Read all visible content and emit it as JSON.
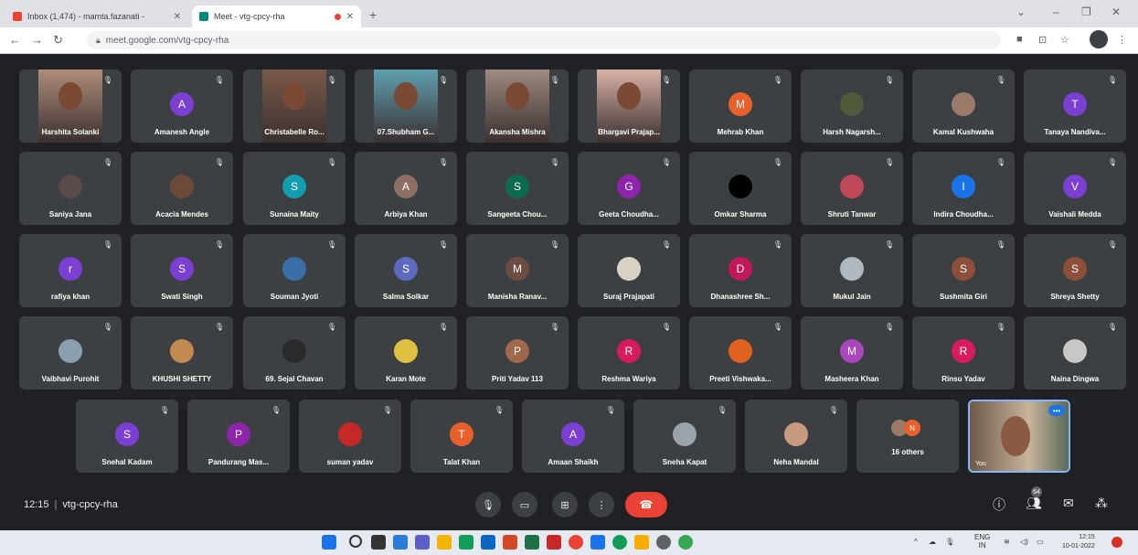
{
  "browser": {
    "tabs": [
      {
        "label": "Inbox (1,474) - mamta.fazanati - "
      },
      {
        "label": "Meet - vtg-cpcy-rha"
      }
    ],
    "url": "meet.google.com/vtg-cpcy-rha"
  },
  "meeting": {
    "time": "12:15",
    "code": "vtg-cpcy-rha",
    "participant_count": "64",
    "others_label": "16 others",
    "self_label": "You"
  },
  "participants": [
    {
      "name": "Harshita Solanki",
      "type": "video",
      "color": "#b08d7a"
    },
    {
      "name": "Amanesh Angle",
      "type": "avatar",
      "initial": "A",
      "color": "#7b3fd4"
    },
    {
      "name": "Christabelle Ro...",
      "type": "video",
      "color": "#7a5a4a"
    },
    {
      "name": "07.Shubham G...",
      "type": "video",
      "color": "#5fa0b0"
    },
    {
      "name": "Akansha Mishra",
      "type": "video",
      "color": "#9e8a80"
    },
    {
      "name": "Bhargavi Prajap...",
      "type": "video",
      "color": "#d9b2a8"
    },
    {
      "name": "Mehrab Khan",
      "type": "avatar",
      "initial": "M",
      "color": "#e8612c"
    },
    {
      "name": "Harsh Nagarsh...",
      "type": "photo",
      "color": "#4e5a3a"
    },
    {
      "name": "Kamal Kushwaha",
      "type": "photo",
      "color": "#9a7b6a"
    },
    {
      "name": "Tanaya Nandiva...",
      "type": "avatar",
      "initial": "T",
      "color": "#7b3fd4"
    },
    {
      "name": "Saniya Jana",
      "type": "photo",
      "color": "#5a4a4a"
    },
    {
      "name": "Acacia Mendes",
      "type": "photo",
      "color": "#6b4a3a"
    },
    {
      "name": "Sunaina Maity",
      "type": "avatar",
      "initial": "S",
      "color": "#129eaf"
    },
    {
      "name": "Arbiya Khan",
      "type": "avatar",
      "initial": "A",
      "color": "#8d6e63"
    },
    {
      "name": "Sangeeta Chou...",
      "type": "avatar",
      "initial": "S",
      "color": "#0b6b4f"
    },
    {
      "name": "Geeta Choudha...",
      "type": "avatar",
      "initial": "G",
      "color": "#8e24aa"
    },
    {
      "name": "Omkar Sharma",
      "type": "photo",
      "color": "#000000"
    },
    {
      "name": "Shruti Tanwar",
      "type": "photo",
      "color": "#c0475a"
    },
    {
      "name": "Indira Choudha...",
      "type": "avatar",
      "initial": "I",
      "color": "#1a73e8"
    },
    {
      "name": "Vaishali Medda",
      "type": "avatar",
      "initial": "V",
      "color": "#7b3fd4"
    },
    {
      "name": "rafiya khan",
      "type": "avatar",
      "initial": "r",
      "color": "#7b3fd4"
    },
    {
      "name": "Swati Singh",
      "type": "avatar",
      "initial": "S",
      "color": "#7b3fd4"
    },
    {
      "name": "Souman Jyoti",
      "type": "photo",
      "color": "#3a6ea8"
    },
    {
      "name": "Salma Solkar",
      "type": "avatar",
      "initial": "S",
      "color": "#5c6bc0"
    },
    {
      "name": "Manisha Ranav...",
      "type": "avatar",
      "initial": "M",
      "color": "#6d4c41"
    },
    {
      "name": "Suraj Prajapati",
      "type": "photo",
      "color": "#d8d2c4"
    },
    {
      "name": "Dhanashree Sh...",
      "type": "avatar",
      "initial": "D",
      "color": "#c2185b"
    },
    {
      "name": "Mukul Jain",
      "type": "photo",
      "color": "#b0b8c0"
    },
    {
      "name": "Sushmita Giri",
      "type": "avatar",
      "initial": "S",
      "color": "#8d4e3a"
    },
    {
      "name": "Shreya Shetty",
      "type": "avatar",
      "initial": "S",
      "color": "#8d4e3a"
    },
    {
      "name": "Vaibhavi Purohit",
      "type": "photo",
      "color": "#8aa0b0"
    },
    {
      "name": "KHUSHI SHETTY",
      "type": "photo",
      "color": "#c08a50"
    },
    {
      "name": "69. Sejal Chavan",
      "type": "photo",
      "color": "#2a2a2a"
    },
    {
      "name": "Karan Mote",
      "type": "photo",
      "color": "#e0c040"
    },
    {
      "name": "Priti Yadav 113",
      "type": "avatar",
      "initial": "P",
      "color": "#a1674a"
    },
    {
      "name": "Reshma Wariya",
      "type": "avatar",
      "initial": "R",
      "color": "#d81b60"
    },
    {
      "name": "Preeti Vishwaka...",
      "type": "photo",
      "color": "#e06020"
    },
    {
      "name": "Masheera Khan",
      "type": "avatar",
      "initial": "M",
      "color": "#ab47bc"
    },
    {
      "name": "Rinsu Yadav",
      "type": "avatar",
      "initial": "R",
      "color": "#d81b60"
    },
    {
      "name": "Naina Dingwa",
      "type": "photo",
      "color": "#c8c8c8"
    },
    {
      "name": "Snehal Kadam",
      "type": "avatar",
      "initial": "S",
      "color": "#7b3fd4"
    },
    {
      "name": "Pandurang Mas...",
      "type": "avatar",
      "initial": "P",
      "color": "#8e24aa"
    },
    {
      "name": "suman yadav",
      "type": "photo",
      "color": "#c62828"
    },
    {
      "name": "Talat Khan",
      "type": "avatar",
      "initial": "T",
      "color": "#e8612c"
    },
    {
      "name": "Amaan Shaikh",
      "type": "avatar",
      "initial": "A",
      "color": "#7b3fd4"
    },
    {
      "name": "Sneha Kapat",
      "type": "photo",
      "color": "#9aa4a8"
    },
    {
      "name": "Neha Mandal",
      "type": "photo",
      "color": "#c89a80"
    }
  ],
  "taskbar": {
    "lang": "ENG",
    "region": "IN",
    "time": "12:15",
    "date": "10-01-2022"
  },
  "icons": {
    "mic_off": "mic-off-icon",
    "camera": "camera-icon",
    "present": "present-icon",
    "more": "more-icon",
    "end_call": "end-call-icon",
    "info": "info-icon",
    "people": "people-icon",
    "chat": "chat-icon",
    "activities": "activities-icon"
  }
}
